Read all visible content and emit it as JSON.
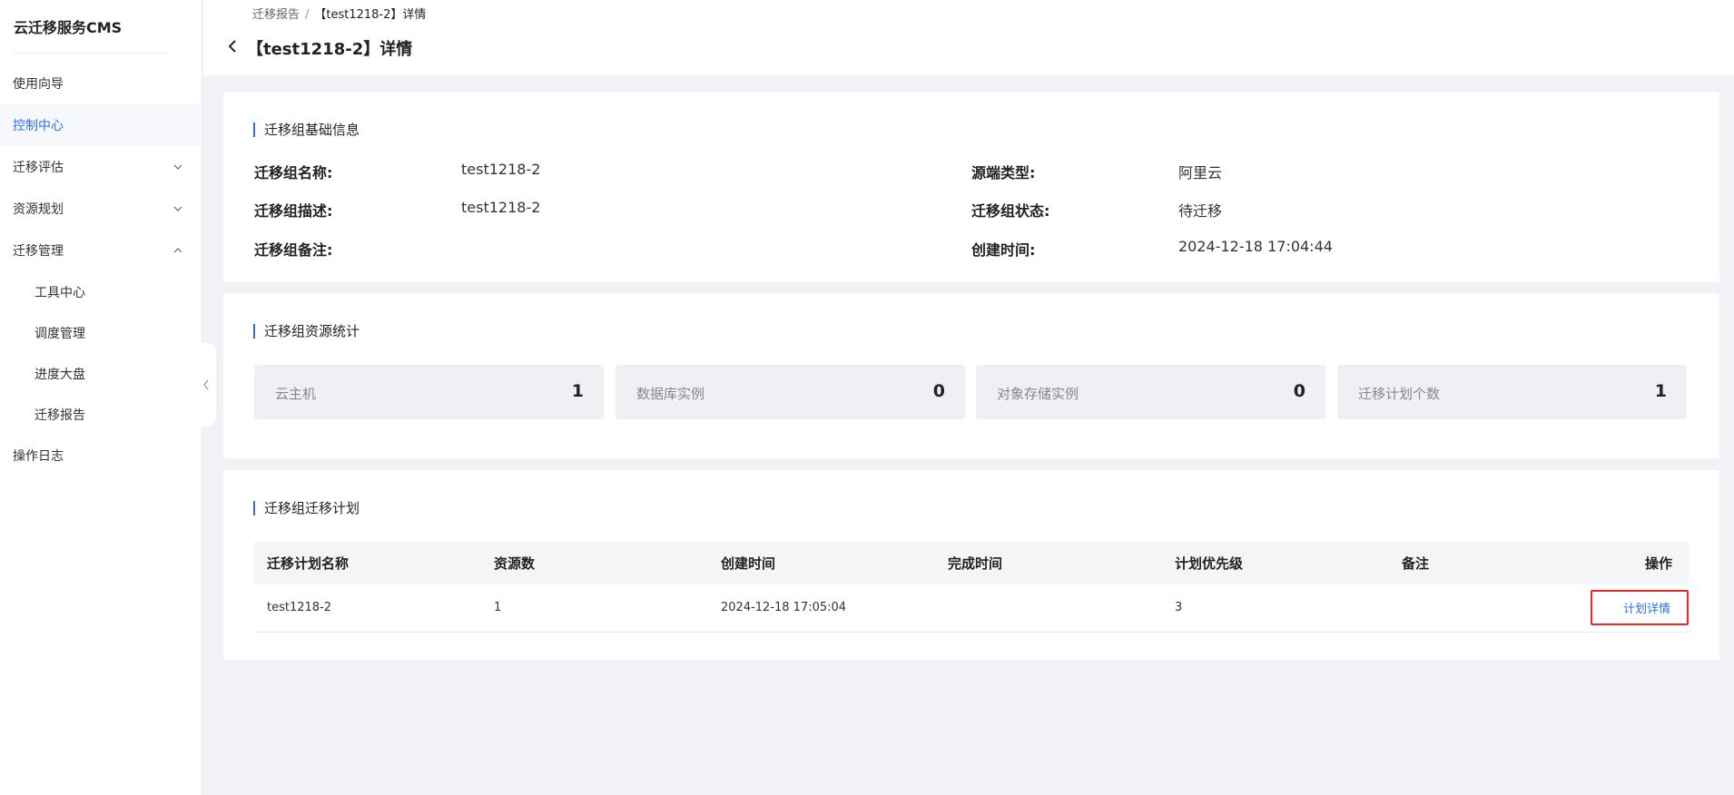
{
  "app": {
    "title": "云迁移服务CMS"
  },
  "sidebar": {
    "items": [
      {
        "label": "使用向导"
      },
      {
        "label": "控制中心"
      },
      {
        "label": "迁移评估"
      },
      {
        "label": "资源规划"
      },
      {
        "label": "迁移管理"
      },
      {
        "label": "工具中心"
      },
      {
        "label": "调度管理"
      },
      {
        "label": "进度大盘"
      },
      {
        "label": "迁移报告"
      },
      {
        "label": "操作日志"
      }
    ],
    "active": "控制中心"
  },
  "header": {
    "breadcrumb": [
      "迁移报告",
      "【test1218-2】详情"
    ],
    "breadcrumb_sep": "/",
    "title": "【test1218-2】详情"
  },
  "basic_info": {
    "title": "迁移组基础信息",
    "fields": [
      {
        "label": "迁移组名称:",
        "value": "test1218-2"
      },
      {
        "label": "迁移组描述:",
        "value": "test1218-2"
      },
      {
        "label": "迁移组备注:",
        "value": ""
      },
      {
        "label": "源端类型:",
        "value": "阿里云"
      },
      {
        "label": "迁移组状态:",
        "value": "待迁移"
      },
      {
        "label": "创建时间:",
        "value": "2024-12-18 17:04:44"
      }
    ]
  },
  "resource_stats": {
    "title": "迁移组资源统计",
    "items": [
      {
        "label": "云主机",
        "value": "1"
      },
      {
        "label": "数据库实例",
        "value": "0"
      },
      {
        "label": "对象存储实例",
        "value": "0"
      },
      {
        "label": "迁移计划个数",
        "value": "1"
      }
    ]
  },
  "plans": {
    "title": "迁移组迁移计划",
    "columns": [
      "迁移计划名称",
      "资源数",
      "创建时间",
      "完成时间",
      "计划优先级",
      "备注",
      "操作"
    ],
    "rows": [
      {
        "name": "test1218-2",
        "resources": "1",
        "created": "2024-12-18 17:05:04",
        "finished": "",
        "priority": "3",
        "remark": "",
        "action": "计划详情"
      }
    ]
  },
  "colors": {
    "accent": "#2f6ee9",
    "highlight_border": "#e8262d",
    "page_bg": "#f0f2f5"
  },
  "icons": [
    "chevron-down-icon",
    "chevron-up-icon",
    "chevron-left-icon",
    "back-arrow-icon"
  ]
}
